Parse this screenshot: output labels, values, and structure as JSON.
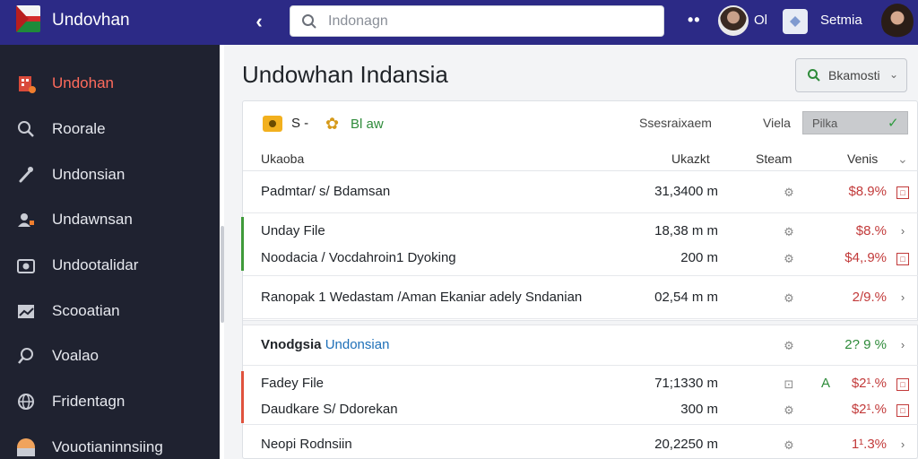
{
  "app": {
    "name": "Undovhan",
    "flag_colors": [
      "#f4f4f4",
      "#d42b2b",
      "#1f8a3a"
    ]
  },
  "topbar": {
    "search_placeholder": "Indonagn",
    "user_abbr": "Ol",
    "user_name": "Setmia"
  },
  "sidebar": {
    "items": [
      {
        "label": "Undohan",
        "icon": "building-icon",
        "active": true
      },
      {
        "label": "Roorale",
        "icon": "search-icon",
        "active": false
      },
      {
        "label": "Undonsian",
        "icon": "wrench-icon",
        "active": false
      },
      {
        "label": "Undawnsan",
        "icon": "users-icon",
        "active": false
      },
      {
        "label": "Undootalidar",
        "icon": "camera-icon",
        "active": false
      },
      {
        "label": "Scooatian",
        "icon": "chart-icon",
        "active": false
      },
      {
        "label": "Voalao",
        "icon": "magnifier-icon",
        "active": false
      },
      {
        "label": "Fridentagn",
        "icon": "globe-icon",
        "active": false
      },
      {
        "label": "Vouotianinnsiing",
        "icon": "avatar-icon",
        "active": false
      }
    ]
  },
  "main": {
    "title": "Undowhan Indansia",
    "filter_button": "Bkamosti",
    "toolbar": {
      "s_label": "S -",
      "b_label": "Bl aw",
      "sessions_label": "Ssesraixaem",
      "view_label": "Viela",
      "view_select": "Pilka"
    },
    "columns": {
      "name": "Ukaoba",
      "size": "Ukazkt",
      "status": "Steam",
      "percent": "Venis"
    },
    "rows": [
      {
        "name": "Padmtar/ s/ Bdamsan",
        "size": "31,3400 m",
        "percent": "$8.9%",
        "pct_color": "red",
        "action": "box"
      },
      {
        "name": "Unday File",
        "size": "18,38 m m",
        "percent": "$8.%",
        "pct_color": "red",
        "action": "chevron"
      },
      {
        "name": "Noodacia / Vocdahroin1 Dyoking",
        "size": "200 m",
        "percent": "$4,.9%",
        "pct_color": "red",
        "action": "box"
      },
      {
        "name": "Ranopak 1 Wedastam /Aman Ekaniar adely Sndanian",
        "size": "02,54 m m",
        "percent": "2/9.%",
        "pct_color": "red",
        "action": "chevron"
      },
      {
        "name_bold": "Vnodgsia",
        "name_blue": "Undonsian",
        "size": "",
        "percent": "2? 9 %",
        "pct_color": "green",
        "action": "chevron"
      },
      {
        "name": "Fadey File",
        "size": "71;1330 m",
        "percent": "$2¹.%",
        "pct_color": "red",
        "action": "box",
        "flag": "A"
      },
      {
        "name": "Daudkare S/ Ddorekan",
        "size": "300 m",
        "percent": "$2¹.%",
        "pct_color": "red",
        "action": "box"
      },
      {
        "name": "Neopi Rodnsiin",
        "size": "20,2250 m",
        "percent": "1¹.3%",
        "pct_color": "red",
        "action": "chevron"
      }
    ],
    "accent_colors": {
      "green": "#3f9a3a",
      "red": "#e0523d"
    }
  }
}
